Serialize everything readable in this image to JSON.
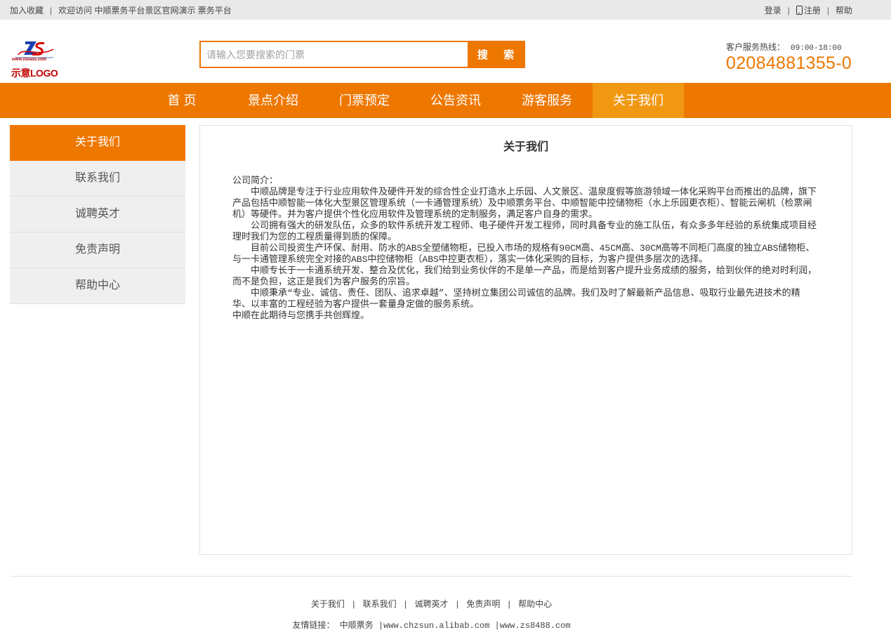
{
  "topbar": {
    "left_links": [
      "加入收藏",
      "欢迎访问 中顺票务平台景区官网演示 票务平台"
    ],
    "separator": "|",
    "login": "登录",
    "register": "注册",
    "help": "帮助"
  },
  "header": {
    "logo": {
      "url_text": "www.zssass.com",
      "caption": "示意LOGO"
    },
    "search": {
      "placeholder": "请输入您要搜索的门票",
      "button_label": "搜 索"
    },
    "hotline": {
      "label": "客户服务热线：",
      "hours": "09:00-18:00",
      "phone": "02084881355-0"
    }
  },
  "nav": {
    "items": [
      {
        "label": "首 页",
        "active": false
      },
      {
        "label": "景点介绍",
        "active": false
      },
      {
        "label": "门票预定",
        "active": false
      },
      {
        "label": "公告资讯",
        "active": false
      },
      {
        "label": "游客服务",
        "active": false
      },
      {
        "label": "关于我们",
        "active": true
      }
    ]
  },
  "sidebar": {
    "items": [
      {
        "label": "关于我们",
        "active": true
      },
      {
        "label": "联系我们",
        "active": false
      },
      {
        "label": "诚聘英才",
        "active": false
      },
      {
        "label": "免责声明",
        "active": false
      },
      {
        "label": "帮助中心",
        "active": false
      }
    ]
  },
  "content": {
    "title": "关于我们",
    "paragraphs": [
      "公司简介：",
      "中顺品牌是专注于行业应用软件及硬件开发的综合性企业打造水上乐园、人文景区、温泉度假等旅游领域一体化采购平台而推出的品牌，旗下产品包括中顺智能一体化大型景区管理系统（一卡通管理系统）及中顺票务平台、中顺智能中控储物柜（水上乐园更衣柜）、智能云闸机（检票闸机）等硬件。并为客户提供个性化应用软件及管理系统的定制服务，满足客户自身的需求。",
      "公司拥有强大的研发队伍，众多的软件系统开发工程师、电子硬件开发工程师，同时具备专业的施工队伍，有众多多年经验的系统集成项目经理时我们为您的工程质量得到质的保障。",
      "目前公司投资生产环保、耐用、防水的ABS全塑储物柜，已投入市场的规格有90CM高、45CM高、30CM高等不同柜门高度的独立ABS储物柜、与一卡通管理系统完全对接的ABS中控储物柜（ABS中控更衣柜），落实一体化采购的目标，为客户提供多层次的选择。",
      "中顺专长于一卡通系统开发、整合及优化，我们给到业务伙伴的不是单一产品，而是给到客户提升业务成绩的服务，给到伙伴的绝对时利润，而不是负担，这正是我们为客户服务的宗旨。",
      "中顺秉承“专业、诚信、责任、团队、追求卓越”、坚持树立集团公司诚信的品牌。我们及时了解最新产品信息、吸取行业最先进技术的精华、以丰富的工程经验为客户提供一套量身定做的服务系统。",
      "中顺在此期待与您携手共创辉煌。"
    ]
  },
  "footer": {
    "links": [
      "关于我们",
      "联系我们",
      "诚聘英才",
      "免责声明",
      "帮助中心"
    ],
    "separator": "|",
    "friend_label": "友情链接：",
    "friend_links": [
      "中顺票务",
      "www.chzsun.alibab.com",
      "www.zs8488.com"
    ]
  },
  "colors": {
    "accent": "#ee7700",
    "nav_active": "#f19813",
    "topbar_bg": "#e9e9e9",
    "sidebar_bg": "#efefef"
  }
}
